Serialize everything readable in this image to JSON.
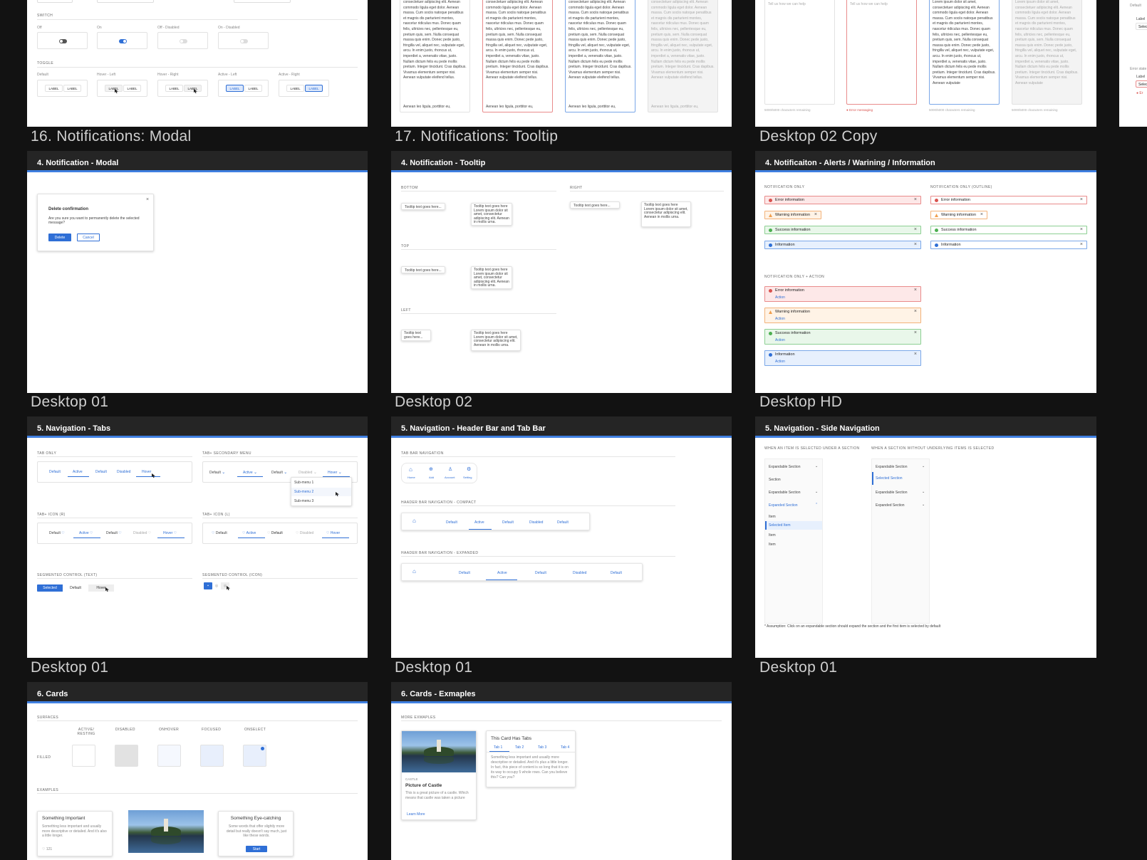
{
  "frame_labels": {
    "f16": "16. Notifications: Modal",
    "f17": "17. Notifications: Tooltip",
    "d02copy": "Desktop 02 Copy",
    "d01a": "Desktop 01",
    "d02": "Desktop 02",
    "dhd": "Desktop HD",
    "d01b": "Desktop 01",
    "d01c": "Desktop 01",
    "d01d": "Desktop 01"
  },
  "switch_board": {
    "switch_title": "SWITCH",
    "switch_labels": [
      "Off",
      "On",
      "Off - Disabled",
      "On - Disabled"
    ],
    "toggle_title": "TOGGLE",
    "toggle_labels": [
      "Default",
      "Hover - Left",
      "Hover - Right",
      "Active - Left",
      "Active - Right"
    ],
    "label": "LABEL"
  },
  "textarea_board": {
    "lorem": "consectetuer adipiscing elit. Aenean commodo ligula eget dolor. Aenean massa. Cum sociis natoque penatibus et magnis dis parturient montes, nascetur ridiculus mus. Donec quam felis, ultricies nec, pellentesque eu, pretium quis, sem. Nulla consequat massa quis enim. Donec pede justo, fringilla vel, aliquet nec, vulputate eget, arcu. In enim justo, rhoncus ut, imperdiet a, venenatis vitae, justo. Nullam dictum felis eu pede mollis pretium. Integer tincidunt. Cras dapibus. Vivamus elementum semper nisi. Aenean vulputate eleifend tellus.",
    "lorem_tail": "Aenean leo ligula, porttitor eu,"
  },
  "desktop02copy_board": {
    "placeholder": "Tell us how we can help",
    "lorem": "Lorem ipsum dolor sit amet, consectetuer adipiscing elit. Aenean commodo ligula eget dolor. Aenean massa. Cum sociis natoque penatibus et magnis dis parturient montes, nascetur ridiculus mus. Donec quam felis, ultricies nec, pellentesque eu, pretium quis, sem. Nulla consequat massa quis enim. Donec pede justo, fringilla vel, aliquet nec, vulputate eget, arcu. In enim justo, rhoncus ut, imperdiet a, venenatis vitae, justo. Nullam dictum felis eu pede mollis pretium. Integer tincidunt. Cras dapibus. Vivamus elementum semper nisi. Aenean vulputate",
    "remaining": "5000/5000 characters remaining",
    "error": "Error messaging"
  },
  "partial_board": {
    "default": "Default",
    "label": "Label",
    "select": "Select",
    "error_state": "Error state"
  },
  "modal_board": {
    "header": "4. Notification - Modal",
    "title": "Delete confirmation",
    "message": "Are you sure you want to permanently delete the selected message?",
    "delete": "Delete",
    "cancel": "Cancel"
  },
  "tooltip_board": {
    "header": "4. Notification - Tooltip",
    "bottom": "BOTTOM",
    "right": "RIGHT",
    "top": "TOP",
    "left": "LEFT",
    "short": "Tooltip text goes here...",
    "long": "Tooltip text goes here Lorem ipsum dolor sit amet, consectetur adipiscing elit. Aenean in mollis urna.",
    "short_left": "Tooltip text goes here..."
  },
  "alerts_board": {
    "header": "4. Notificaiton - Alerts / Warining / Information",
    "only": "NOTIFICATION ONLY",
    "only_outline": "NOTIFICATION ONLY (OUTLINE)",
    "with_action": "NOTIFICATION ONLY + ACTION",
    "error": "Error information",
    "warning": "Warning information",
    "success": "Success information",
    "info": "Information",
    "action": "Action"
  },
  "tabs_board": {
    "header": "5. Navigation - Tabs",
    "tab_only": "TAB ONLY",
    "tab_secondary": "TAB+ SECONDARY MENU",
    "tab_icon_r": "TAB+ ICON (R)",
    "tab_icon_l": "TAB+ ICON (L)",
    "seg_text": "SEGMENTED CONTROL (TEXT)",
    "seg_icon": "SEGMENTED CONTROL (ICON)",
    "default": "Default",
    "active": "Active",
    "disabled": "Disabled",
    "hover": "Hover",
    "selected": "Selected",
    "submenus": [
      "Sub-menu 1",
      "Sub-menu 2",
      "Sub-menu 3"
    ]
  },
  "header_board": {
    "header": "5. Navigation - Header Bar and Tab Bar",
    "tab_bar_nav": "TAB BAR NAVIGATION",
    "compact": "HAADER BAR NAVIGATION - COMPACT",
    "expanded": "HAADER BAR NAVIGATION - EXPANDED",
    "tab_items": [
      "Home",
      "Add",
      "Account",
      "Setting"
    ],
    "default": "Default",
    "active": "Active",
    "disabled": "Disabled"
  },
  "side_board": {
    "header": "5. Navigation - Side Navigation",
    "left_title": "WHEN AN ITEM IS SELECTED UNDER A SECTION",
    "right_title": "WHEN A SECTION WITHOUT UNDERLYING ITEMS IS SELECTED",
    "expandable": "Expandable Section",
    "section": "Section",
    "expanded": "Expanded Section",
    "item": "Item",
    "selected_item": "Selected Item",
    "selected_section": "Selected Section",
    "note": "* Assumption: Click on an expandable section should expand the section and the first item is selected by default"
  },
  "cards_board": {
    "header": "6. Cards",
    "surfaces": "SURFACES",
    "filled": "FILLED",
    "states": [
      "ACTIVE/ RESTING",
      "DISABLED",
      "ONHOVER",
      "FOCUSED",
      "ONSELECT"
    ],
    "examples": "EXAMPLES",
    "card1_title": "Something Important",
    "card1_body": "Something less important and usually more descriptive or detailed. And it's also a little longer.",
    "card1_count": "121",
    "card3_title": "Something Eye-catching",
    "card3_body": "Some words that offer slightly more detail but really doesn't say much, just like these words.",
    "card3_btn": "Start"
  },
  "cards_ex_board": {
    "header": "6. Cards - Exmaples",
    "more": "MORE EXMAPLES",
    "overline": "CASTLE",
    "title": "Picture of Castle",
    "body": "This is a great picture of a castle. Which means that castle was taken a picture",
    "learn": "Learn More",
    "tabs_title": "This Card Has Tabs",
    "tabs": [
      "Tab 1",
      "Tab 2",
      "Tab 3",
      "Tab 4"
    ],
    "tabs_body": "Something less important and usually more descriptive or detailed. And it's plus a little longer. In fact, this piece of content is so long that it is on its way to occupy 5 whole rows. Can you believe this? Can you?"
  }
}
